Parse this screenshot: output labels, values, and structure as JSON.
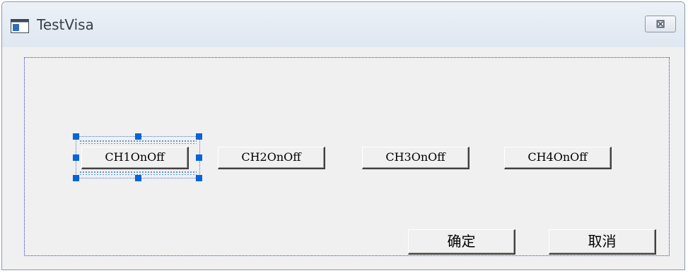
{
  "window": {
    "title": "TestVisa",
    "close_glyph": "⊠",
    "icon": "app-window-icon"
  },
  "buttons": {
    "ch": [
      "CH1OnOff",
      "CH2OnOff",
      "CH3OnOff",
      "CH4OnOff"
    ],
    "ok": "确定",
    "cancel": "取消"
  },
  "colors": {
    "selection_handle": "#0a64d8",
    "frame_dotted": "#3040c0"
  }
}
